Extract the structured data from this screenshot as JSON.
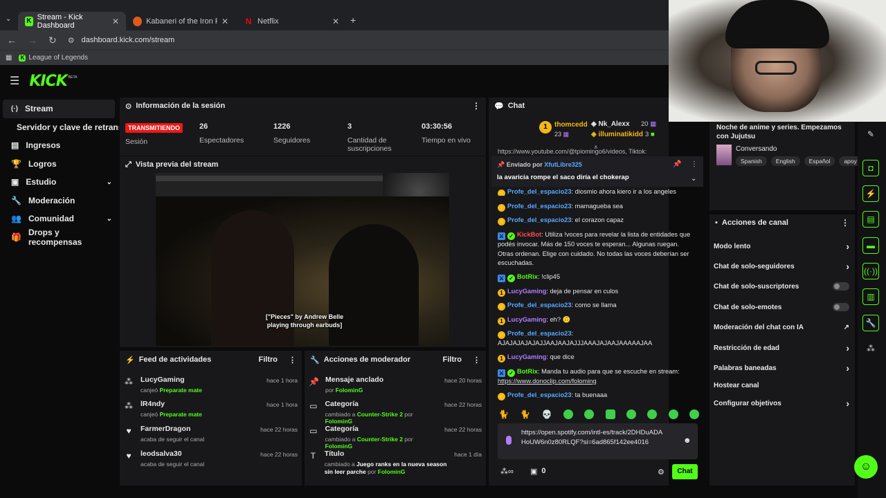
{
  "browser": {
    "tabs": [
      {
        "title": "Stream - Kick Dashboard",
        "active": true
      },
      {
        "title": "Kabaneri of the Iron Fortress en",
        "active": false
      },
      {
        "title": "Netflix",
        "active": false
      }
    ],
    "url": "dashboard.kick.com/stream",
    "bookmark": "League of Legends"
  },
  "header": {
    "logo": "KICK",
    "beta": "BETA"
  },
  "sidebar": {
    "items": [
      {
        "label": "Stream",
        "active": true
      },
      {
        "label": "Servidor y clave de retransmisión"
      },
      {
        "label": "Ingresos"
      },
      {
        "label": "Logros"
      },
      {
        "label": "Estudio"
      },
      {
        "label": "Moderación"
      },
      {
        "label": "Comunidad"
      },
      {
        "label": "Drops y recompensas"
      }
    ]
  },
  "session": {
    "title": "Información de la sesión",
    "live_badge": "TRANSMITIENDO",
    "live_label": "Sesión",
    "viewers": "26",
    "viewers_label": "Espectadores",
    "followers": "1226",
    "followers_label": "Seguidores",
    "subs": "3",
    "subs_label": "Cantidad de suscripciones",
    "uptime": "03:30:56",
    "uptime_label": "Tiempo en vivo"
  },
  "preview": {
    "title": "Vista previa del stream",
    "caption": "[\"Pieces\" by Andrew Belle playing through earbuds]"
  },
  "activity": {
    "title": "Feed de actividades",
    "filter": "Filtro",
    "items": [
      {
        "user": "LucyGaming",
        "action": "canjeó",
        "reward": "Preparate mate",
        "time": "hace 1 hora",
        "icon": "redeem-icon"
      },
      {
        "user": "lR4ndy",
        "action": "canjeó",
        "reward": "Preparate mate",
        "time": "hace 1 hora",
        "icon": "redeem-icon"
      },
      {
        "user": "FarmerDragon",
        "action": "acaba de seguir el canal",
        "reward": "",
        "time": "hace 22 horas",
        "icon": "heart-icon"
      },
      {
        "user": "leodsalva30",
        "action": "acaba de seguir el canal",
        "reward": "",
        "time": "hace 22 horas",
        "icon": "heart-icon"
      }
    ]
  },
  "modactions": {
    "title": "Acciones de moderador",
    "filter": "Filtro",
    "items": [
      {
        "title": "Mensaje anclado",
        "pre": "por",
        "value": "",
        "by": "FolominG",
        "time": "hace 20 horas"
      },
      {
        "title": "Categoría",
        "pre": "cambiado a",
        "value": "Counter-Strike 2",
        "by": "FolominG",
        "time": "hace 22 horas"
      },
      {
        "title": "Categoría",
        "pre": "cambiado a",
        "value": "Counter-Strike 2",
        "by": "FolominG",
        "time": "hace 22 horas"
      },
      {
        "title": "Título",
        "pre": "cambiado a",
        "value": "Juego ranks en la nueva season sin leer parche",
        "by": "FolominG",
        "time": "hace 1 día"
      }
    ],
    "por": "por"
  },
  "chat": {
    "title": "Chat",
    "top": [
      {
        "name": "thomcedd",
        "count": "23"
      },
      {
        "name": "Nk_Alexx",
        "count": "20"
      },
      {
        "name": "illuminatikidd",
        "count": "3"
      }
    ],
    "cut_line": "https://www.youtube.com/@tpiomingo6/videos, Tiktok:",
    "pinned_by_label": "Enviado por",
    "pinned_by": "XfutLibre325",
    "pinned_text": "la avaricia rompe el saco diría el chokerap",
    "messages": [
      {
        "user": "Profe_del_espacio23",
        "text": ": diosmio ahora kiero ir a los angeles"
      },
      {
        "user": "Profe_del_espacio23",
        "text": ": mamagueba sea"
      },
      {
        "user": "Profe_del_espacio23",
        "text": ": el corazon capaz"
      },
      {
        "user": "KickBot",
        "text": ": Utiliza !voces para revelar la lista de entidades que podés invocar. Más de 150 voces te esperan... Algunas ruegan. Otras ordenan. Elige con cuidado. No todas las voces deberían ser escuchadas."
      },
      {
        "user": "BotRix",
        "text": ": !clip45"
      },
      {
        "user": "LucyGaming",
        "text": ": deja de pensar en culos"
      },
      {
        "user": "Profe_del_espacio23",
        "text": ": como se llama"
      },
      {
        "user": "LucyGaming",
        "text": ": eh? 🙃"
      },
      {
        "user": "Profe_del_espacio23",
        "text": ":"
      },
      {
        "user": "",
        "text": "AJAJAJAJAJAJJAAJAAJAJJJAAAJAJAAJAAAAAJAA"
      },
      {
        "user": "LucyGaming",
        "text": ": que dice"
      },
      {
        "user": "BotRix",
        "text": ": Manda tu audio para que se escuche en stream:"
      },
      {
        "user": "",
        "text": "https://www.donoclip.com/foloming"
      },
      {
        "user": "Profe_del_espacio23",
        "text": ": ta buenaaa"
      }
    ],
    "input": "https://open.spotify.com/intl-es/track/2DHDuADAHoUW6n0z80RLQF?si=6ad865f142ee4016",
    "points": "0",
    "send": "Chat"
  },
  "stream_info": {
    "title": "Noche de anime y series. Empezamos con Jujutsu",
    "category": "Conversando",
    "tags": [
      "Spanish",
      "English",
      "Español",
      "apoy"
    ]
  },
  "channel_actions": {
    "title": "Acciones de canal",
    "items": [
      {
        "label": "Modo lento",
        "kind": "arrow"
      },
      {
        "label": "Chat de solo-seguidores",
        "kind": "arrow"
      },
      {
        "label": "Chat de solo-suscriptores",
        "kind": "toggle"
      },
      {
        "label": "Chat de solo-emotes",
        "kind": "toggle"
      },
      {
        "label": "Moderación del chat con IA",
        "kind": "external"
      },
      {
        "label": "Restricción de edad",
        "kind": "arrow"
      },
      {
        "label": "Palabras baneadas",
        "kind": "arrow"
      },
      {
        "label": "Hostear canal",
        "kind": "none"
      },
      {
        "label": "Configurar objetivos",
        "kind": "arrow"
      }
    ]
  }
}
